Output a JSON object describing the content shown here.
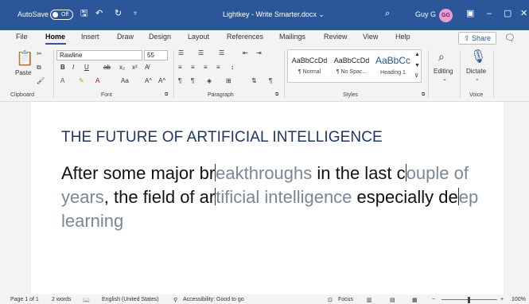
{
  "titlebar": {
    "autosave_label": "AutoSave",
    "autosave_state": "Off",
    "document_title": "Lightkey - Write Smarter.docx",
    "title_chevron": "⌄",
    "user_name": "Guy G",
    "avatar_initials": "GG",
    "save_icon": "save-icon",
    "undo_icon": "undo-icon",
    "redo_icon": "redo-icon",
    "search_icon": "search-icon"
  },
  "menu": {
    "tabs": [
      "File",
      "Home",
      "Insert",
      "Draw",
      "Design",
      "Layout",
      "References",
      "Mailings",
      "Review",
      "View",
      "Help"
    ],
    "active_tab": "Home",
    "share_label": "Share"
  },
  "ribbon": {
    "clipboard": {
      "paste_label": "Paste",
      "group_label": "Clipboard"
    },
    "font": {
      "font_name": "Rawline",
      "font_size": "55",
      "group_label": "Font",
      "grow_label": "A^",
      "shrink_label": "A^",
      "case_label": "Aa"
    },
    "paragraph": {
      "group_label": "Paragraph"
    },
    "styles": {
      "group_label": "Styles",
      "items": [
        {
          "sample": "AaBbCcDd",
          "name": "¶ Normal"
        },
        {
          "sample": "AaBbCcDd",
          "name": "¶ No Spac..."
        },
        {
          "sample": "AaBbCc",
          "name": "Heading 1"
        }
      ]
    },
    "editing_label": "Editing",
    "dictate_label": "Dictate",
    "voice_group_label": "Voice"
  },
  "document": {
    "heading": "THE FUTURE OF ARTIFICIAL INTELLIGENCE",
    "segments": [
      {
        "text": "After some major br",
        "predicted": false,
        "caret_after": true
      },
      {
        "text": "eakthroughs",
        "predicted": true,
        "caret_after": false
      },
      {
        "text": " in the last c",
        "predicted": false,
        "caret_after": true
      },
      {
        "text": "ouple of years",
        "predicted": true,
        "caret_after": false
      },
      {
        "text": ", the field of ar",
        "predicted": false,
        "caret_after": true
      },
      {
        "text": "tificial intelligence",
        "predicted": true,
        "caret_after": false
      },
      {
        "text": " especially de",
        "predicted": false,
        "caret_after": true
      },
      {
        "text": "ep learning",
        "predicted": true,
        "caret_after": false
      }
    ]
  },
  "status": {
    "page": "Page 1 of 1",
    "words": "2 words",
    "language": "English (United States)",
    "accessibility": "Accessibility: Good to go",
    "focus": "Focus",
    "zoom": "100%"
  },
  "colors": {
    "titlebar": "#2b579a",
    "heading": "#1f3763",
    "prediction": "#7a8796"
  }
}
